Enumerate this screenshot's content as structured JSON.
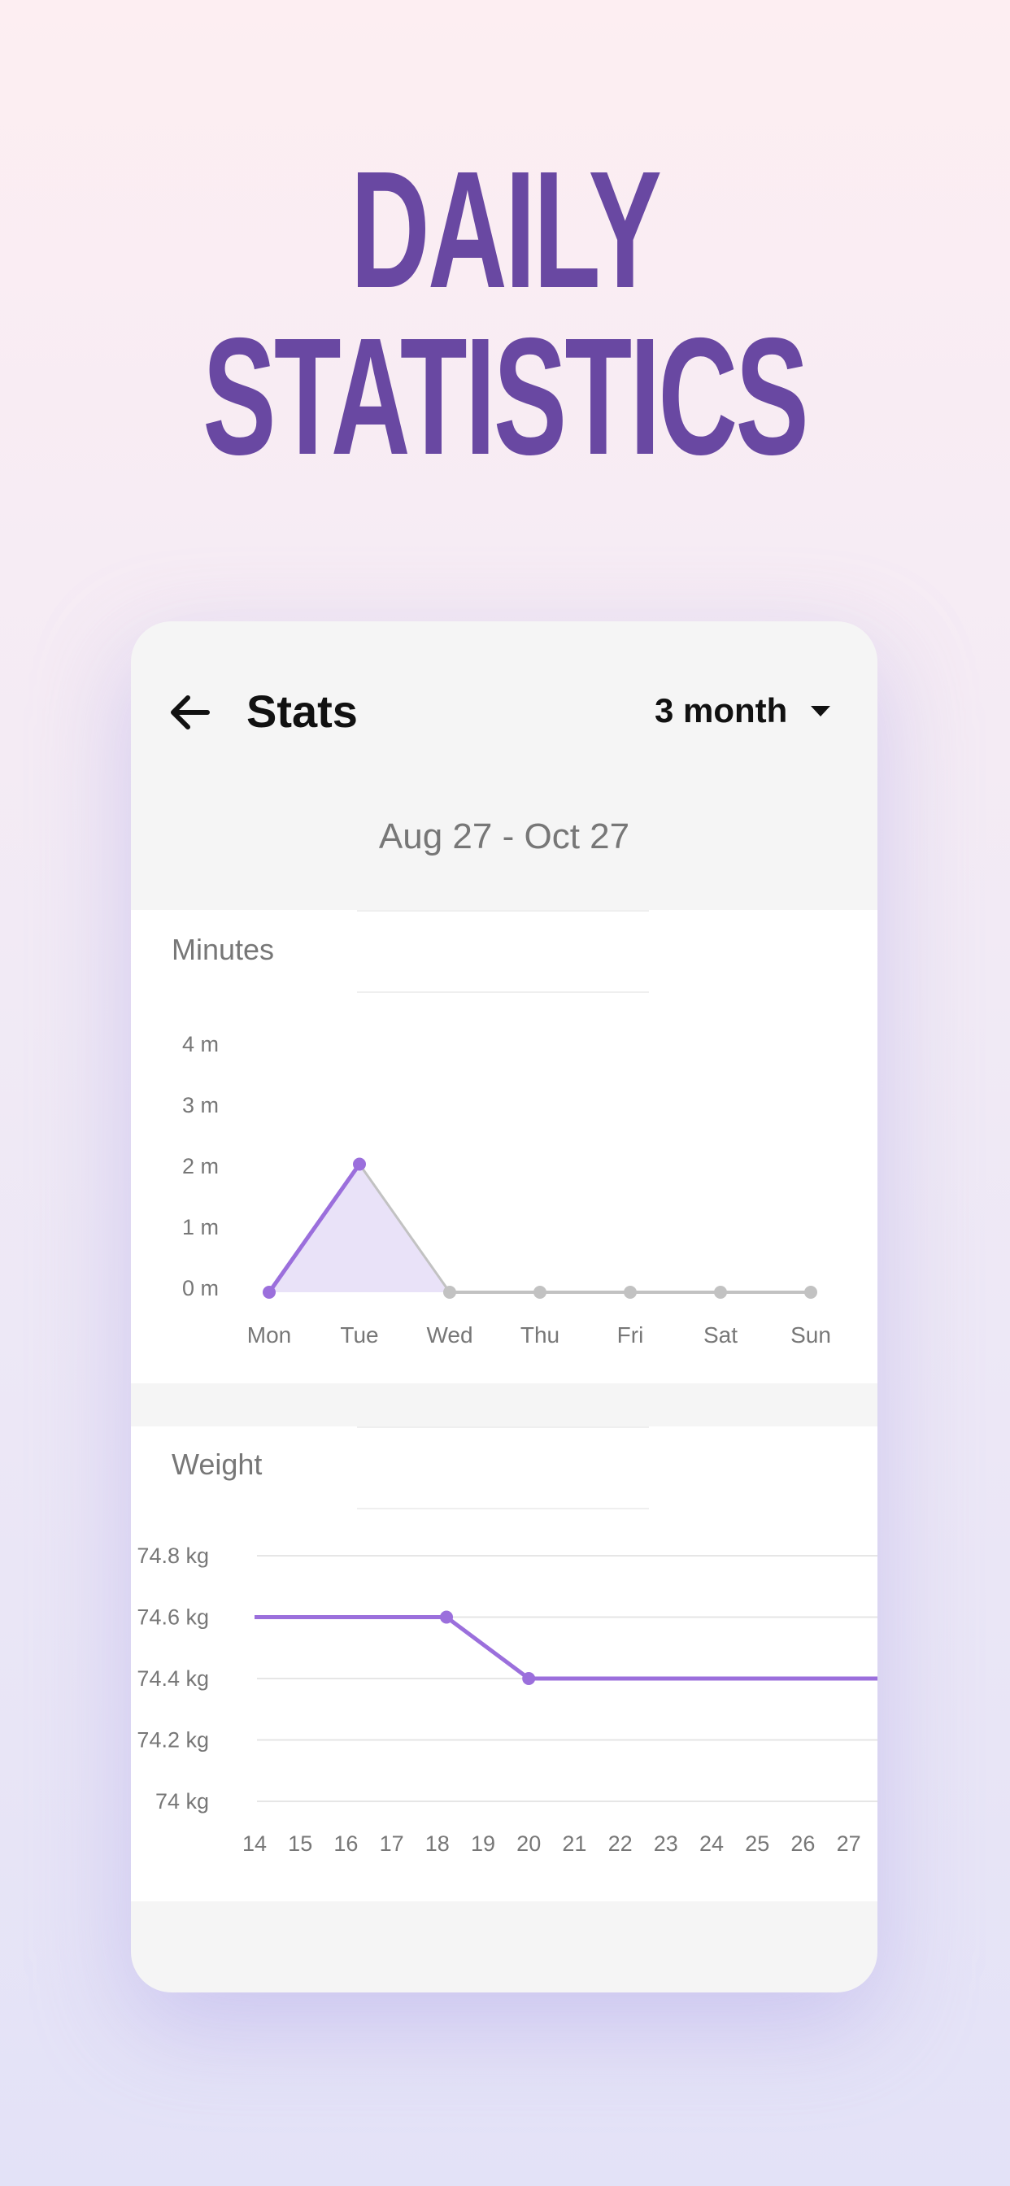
{
  "headline": {
    "line1": "DAILY",
    "line2": "STATISTICS"
  },
  "header": {
    "back_icon": "arrow-left-icon",
    "title": "Stats",
    "range_select": "3 month",
    "range_icon": "caret-down-icon"
  },
  "date_range": "Aug 27 - Oct 27",
  "colors": {
    "accent": "#9b6fdc",
    "title": "#6948a2",
    "fill": "#e9e2f8",
    "inactive": "#c2c2c2"
  },
  "chart_data": [
    {
      "type": "area",
      "title": "Minutes",
      "categories": [
        "Mon",
        "Tue",
        "Wed",
        "Thu",
        "Fri",
        "Sat",
        "Sun"
      ],
      "values": [
        0,
        2.1,
        0,
        0,
        0,
        0,
        0
      ],
      "yticks": [
        "0 m",
        "1 m",
        "2 m",
        "3 m",
        "4 m"
      ],
      "ylim": [
        0,
        4
      ]
    },
    {
      "type": "line",
      "title": "Weight",
      "x": [
        14,
        18.2,
        20,
        27.7
      ],
      "values": [
        74.6,
        74.6,
        74.4,
        74.4
      ],
      "xticks": [
        "14",
        "15",
        "16",
        "17",
        "18",
        "19",
        "20",
        "21",
        "22",
        "23",
        "24",
        "25",
        "26",
        "27"
      ],
      "yticks": [
        "74 kg",
        "74.2 kg",
        "74.4 kg",
        "74.6 kg",
        "74.8 kg"
      ],
      "ylim": [
        74,
        74.8
      ],
      "grid": true
    }
  ]
}
